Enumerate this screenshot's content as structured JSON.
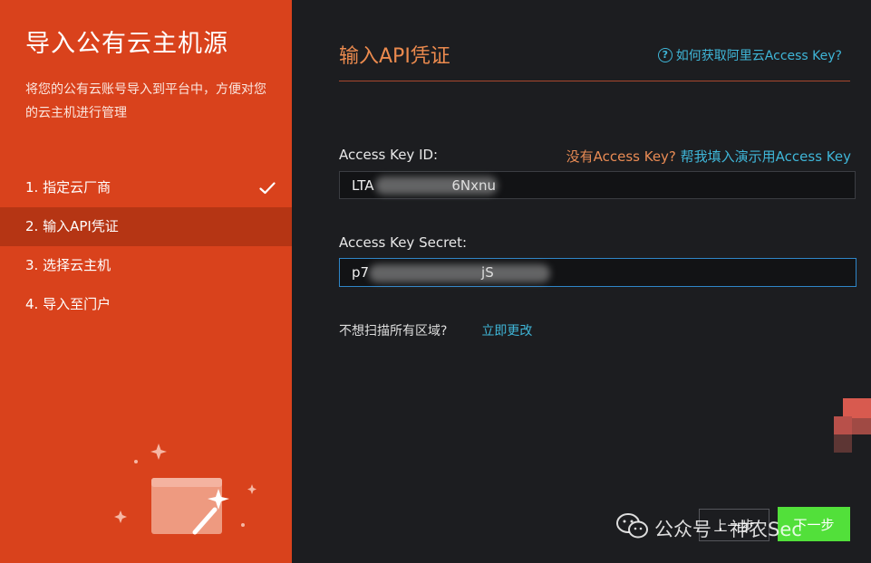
{
  "sidebar": {
    "title": "导入公有云主机源",
    "description": "将您的公有云账号导入到平台中，方便对您的云主机进行管理",
    "steps": [
      {
        "label": "1. 指定云厂商",
        "state": "done"
      },
      {
        "label": "2. 输入API凭证",
        "state": "active"
      },
      {
        "label": "3. 选择云主机",
        "state": "pending"
      },
      {
        "label": "4. 导入至门户",
        "state": "pending"
      }
    ]
  },
  "main": {
    "title": "输入API凭证",
    "help_link": "如何获取阿里云Access Key?",
    "access_key_id": {
      "label": "Access Key ID:",
      "value": "LTA                  6Nxnu",
      "no_key_question": "没有Access Key?",
      "fill_demo_link": "帮我填入演示用Access Key"
    },
    "access_key_secret": {
      "label": "Access Key Secret:",
      "value": "p7                          jS"
    },
    "region": {
      "question": "不想扫描所有区域?",
      "change_link": "立即更改"
    },
    "buttons": {
      "prev": "上一步",
      "next": "下一步"
    }
  },
  "watermark": "公众号 · 神农Sec",
  "icons": {
    "check": "check-icon",
    "help": "question-circle-icon",
    "illustration": "magic-wand-window-icon",
    "watermark": "wechat-icon"
  },
  "colors": {
    "sidebar_bg": "#d9421c",
    "active_step_bg": "#b53514",
    "accent_orange": "#eb8a4e",
    "link_cyan": "#3fb6d8",
    "next_button": "#52e03a",
    "main_bg": "#1c1d20"
  }
}
